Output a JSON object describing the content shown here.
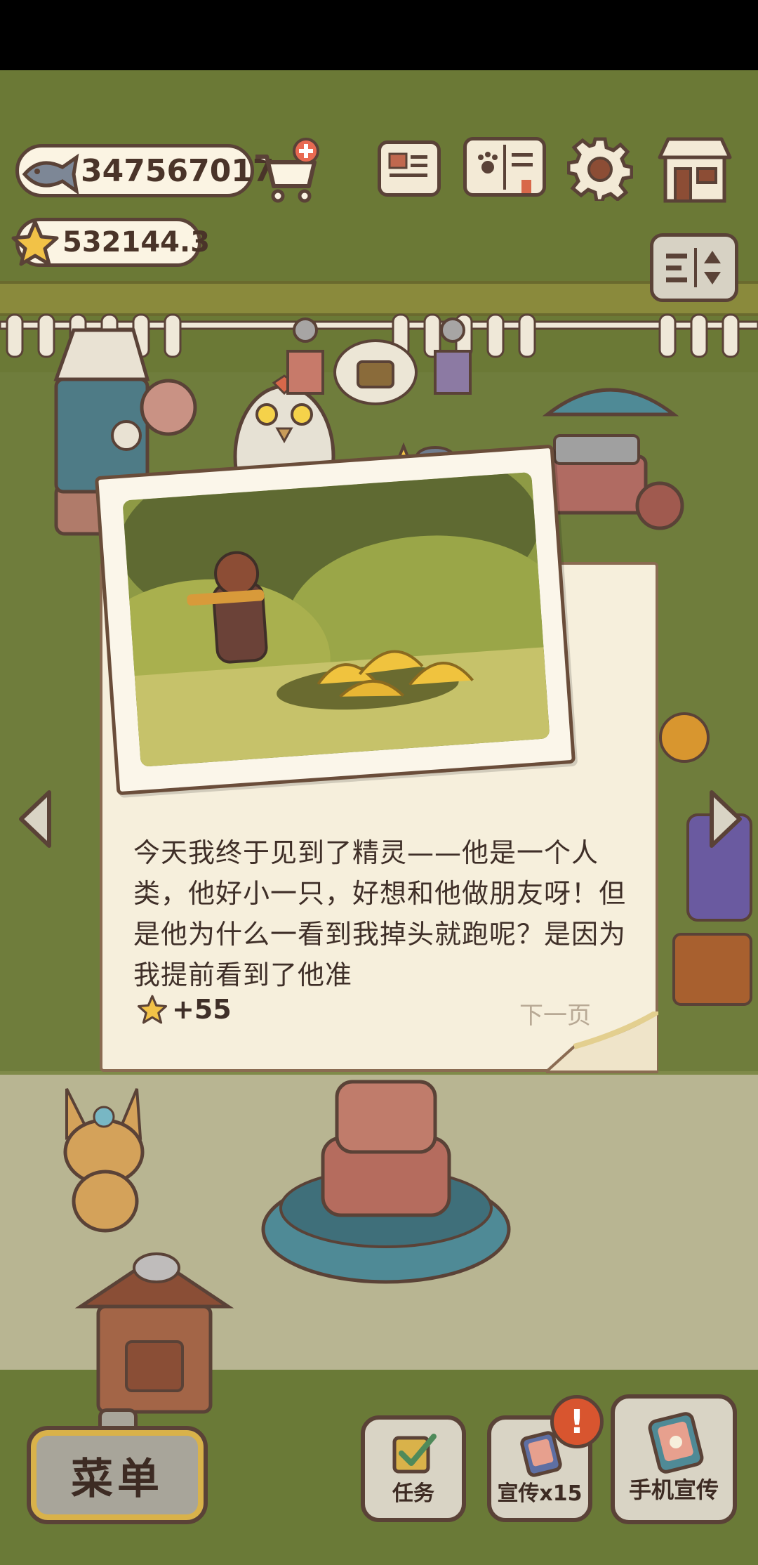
{
  "hud": {
    "fish_currency": "347567017",
    "star_currency": "532144.3"
  },
  "diary": {
    "text": "今天我终于见到了精灵——他是一个人类，他好小一只，好想和他做朋友呀！但是他为什么一看到我掉头就跑呢？是因为我提前看到了他准",
    "reward": "+55",
    "next_page": "下一页"
  },
  "bottom_bar": {
    "menu_label": "菜单",
    "task_label": "任务",
    "promo_label": "宣传x15",
    "phone_promo_label": "手机宣传",
    "alert_badge": "!"
  },
  "icons": {
    "fish": "fish-icon",
    "star": "star-icon",
    "cart": "cart-plus-icon",
    "news": "newspaper-icon",
    "book": "paw-book-icon",
    "settings": "gear-icon",
    "shop": "shop-icon",
    "sort": "sort-icon",
    "task": "checkbox-icon",
    "promo": "tv-icon",
    "phone": "phone-icon"
  },
  "colors": {
    "outline": "#5a4237",
    "paper": "#f6efdc",
    "grass": "#6f7d3c",
    "path": "#b8b592",
    "star": "#f2c247",
    "alert": "#d8552f"
  }
}
